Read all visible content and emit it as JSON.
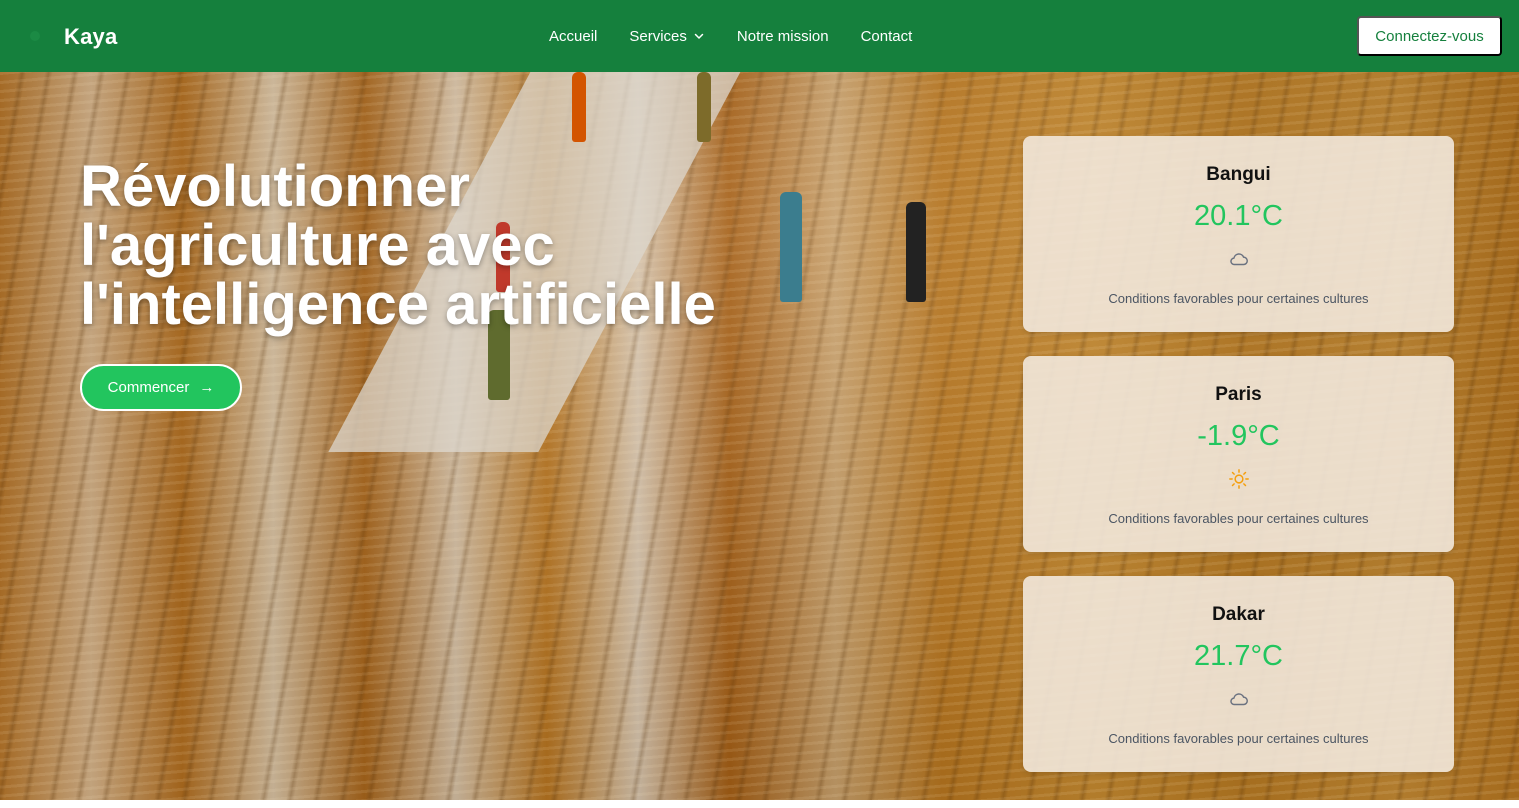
{
  "nav": {
    "brand": "Kaya",
    "links": [
      {
        "label": "Accueil"
      },
      {
        "label": "Services"
      },
      {
        "label": "Notre mission"
      },
      {
        "label": "Contact"
      }
    ],
    "login_label": "Connectez-vous"
  },
  "hero": {
    "title_lines": [
      "Révolutionner",
      "l'agriculture avec",
      "l'intelligence artificielle"
    ],
    "cta_label": "Commencer",
    "cta_arrow": "→"
  },
  "weather": [
    {
      "city": "Bangui",
      "temp": "20.1°C",
      "icon": "cloud-icon",
      "condition": "Conditions favorables pour certaines cultures"
    },
    {
      "city": "Paris",
      "temp": "-1.9°C",
      "icon": "sun-icon",
      "condition": "Conditions favorables pour certaines cultures"
    },
    {
      "city": "Dakar",
      "temp": "21.7°C",
      "icon": "cloud-icon",
      "condition": "Conditions favorables pour certaines cultures"
    }
  ],
  "colors": {
    "nav_bg": "#15803d",
    "accent_green": "#22c55e",
    "sun_yellow": "#f59e0b"
  }
}
